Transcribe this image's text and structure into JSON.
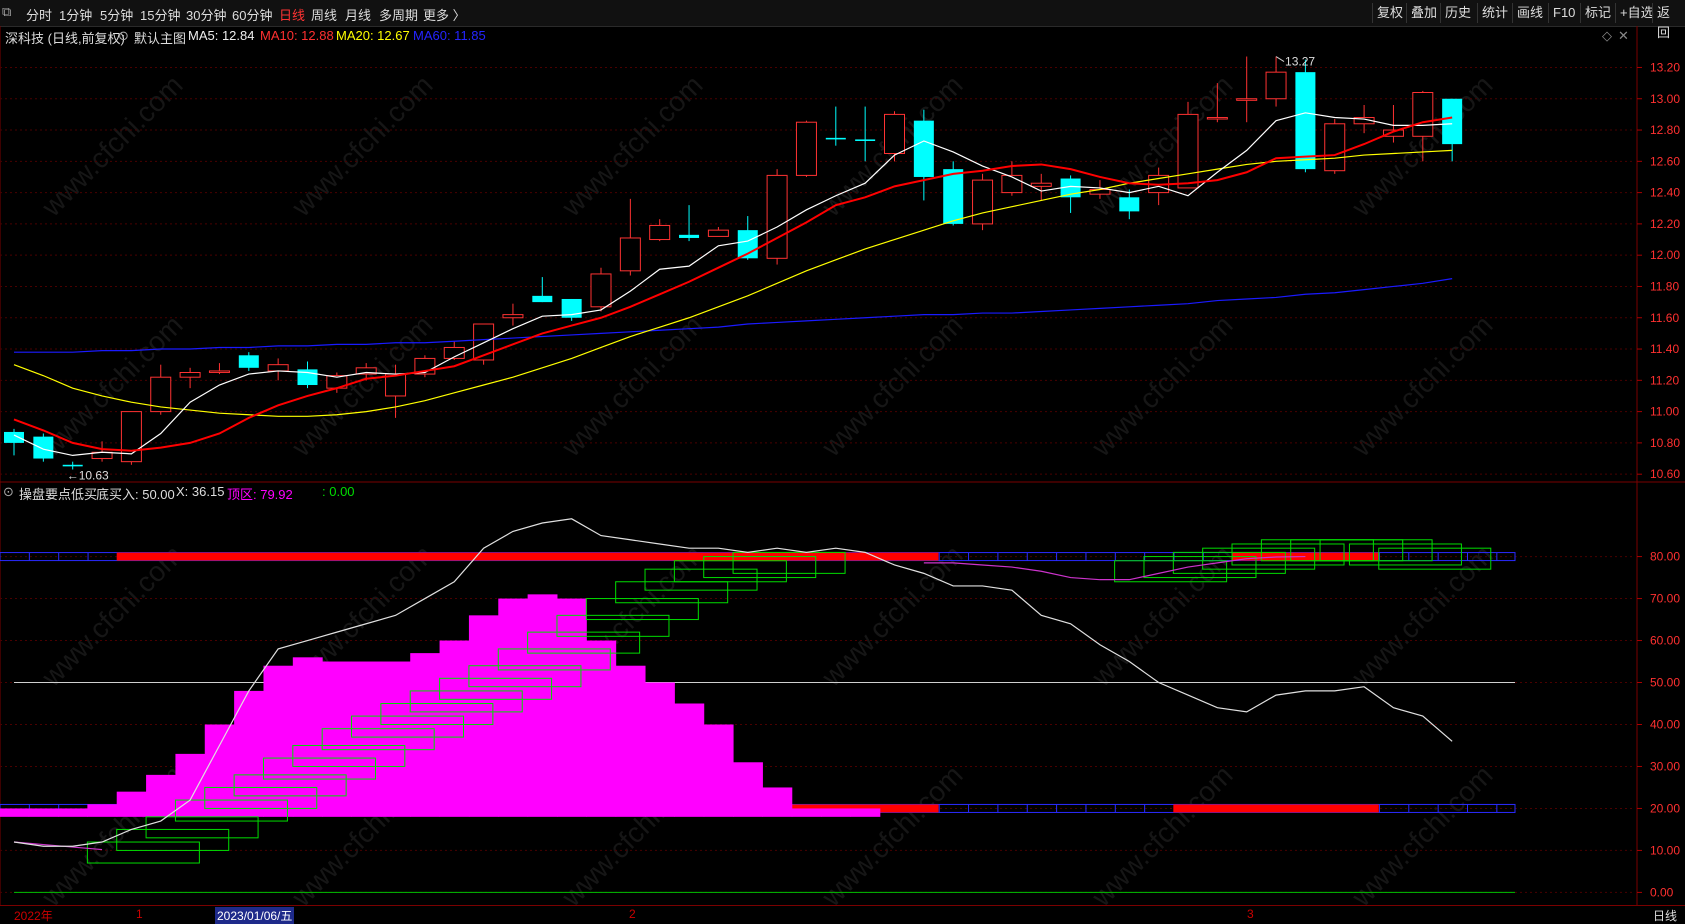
{
  "toolbar": {
    "periods": [
      "分时",
      "1分钟",
      "5分钟",
      "15分钟",
      "30分钟",
      "60分钟",
      "日线",
      "周线",
      "月线",
      "多周期",
      "更多 〉"
    ],
    "active_period": "日线",
    "right_buttons": [
      "复权",
      "叠加",
      "历史",
      "统计",
      "画线",
      "F10",
      "标记",
      "+自选",
      "返回"
    ]
  },
  "main_chart": {
    "stock_label": "深科技 (日线,前复权)",
    "template_label": "默认主图",
    "ma5": "MA5: 12.84",
    "ma10": "MA10: 12.88",
    "ma20": "MA20: 12.67",
    "ma60": "MA60: 11.85",
    "high_marker": "13.27",
    "low_marker": "10.63",
    "yticks": [
      "13.20",
      "13.00",
      "12.80",
      "12.60",
      "12.40",
      "12.20",
      "12.00",
      "11.80",
      "11.60",
      "11.40",
      "11.20",
      "11.00",
      "10.80",
      "10.60"
    ]
  },
  "indicator": {
    "name": "操盘要点低买",
    "bottom_buy": "底买入: 50.00",
    "x_value": "X: 36.15",
    "top_zone": "顶区: 79.92",
    "extra": ": 0.00",
    "yticks": [
      "80.00",
      "70.00",
      "60.00",
      "50.00",
      "40.00",
      "30.00",
      "20.00",
      "10.00",
      "0.00"
    ]
  },
  "timeline": {
    "year": "2022年",
    "m1": "1",
    "date": "2023/01/06/五",
    "m2": "2",
    "m3": "3",
    "period": "日线"
  },
  "watermark": "www.cfchi.com",
  "colors": {
    "up": "#ff3232",
    "down": "#00ffff",
    "ma5": "#ffffff",
    "ma10": "#ff0000",
    "ma20": "#ffff00",
    "ma60": "#1a1aff",
    "magenta": "#ff00ff",
    "green": "#00c000"
  },
  "chart_data": {
    "type": "candlestick",
    "candles": [
      [
        10.87,
        10.8,
        10.89,
        10.72
      ],
      [
        10.84,
        10.7,
        10.86,
        10.68
      ],
      [
        10.66,
        10.65,
        10.68,
        10.63
      ],
      [
        10.7,
        10.74,
        10.81,
        10.68
      ],
      [
        10.68,
        11.0,
        11.0,
        10.66
      ],
      [
        11.0,
        11.22,
        11.3,
        10.98
      ],
      [
        11.22,
        11.25,
        11.28,
        11.15
      ],
      [
        11.26,
        11.26,
        11.31,
        11.24
      ],
      [
        11.36,
        11.28,
        11.38,
        11.26
      ],
      [
        11.26,
        11.3,
        11.34,
        11.2
      ],
      [
        11.27,
        11.17,
        11.32,
        11.15
      ],
      [
        11.15,
        11.23,
        11.25,
        11.12
      ],
      [
        11.24,
        11.28,
        11.31,
        11.2
      ],
      [
        11.1,
        11.24,
        11.3,
        10.96
      ],
      [
        11.24,
        11.34,
        11.36,
        11.22
      ],
      [
        11.34,
        11.41,
        11.45,
        11.33
      ],
      [
        11.33,
        11.56,
        11.56,
        11.3
      ],
      [
        11.6,
        11.62,
        11.69,
        11.55
      ],
      [
        11.74,
        11.7,
        11.86,
        11.7
      ],
      [
        11.72,
        11.6,
        11.72,
        11.58
      ],
      [
        11.67,
        11.88,
        11.92,
        11.64
      ],
      [
        11.9,
        12.11,
        12.36,
        11.87
      ],
      [
        12.1,
        12.19,
        12.23,
        12.09
      ],
      [
        12.13,
        12.11,
        12.32,
        12.09
      ],
      [
        12.12,
        12.16,
        12.18,
        12.12
      ],
      [
        12.16,
        11.98,
        12.25,
        11.97
      ],
      [
        11.98,
        12.51,
        12.55,
        11.94
      ],
      [
        12.51,
        12.85,
        12.86,
        12.5
      ],
      [
        12.75,
        12.74,
        12.95,
        12.7
      ],
      [
        12.74,
        12.73,
        12.95,
        12.6
      ],
      [
        12.65,
        12.9,
        12.92,
        12.6
      ],
      [
        12.86,
        12.5,
        12.93,
        12.35
      ],
      [
        12.55,
        12.2,
        12.6,
        12.19
      ],
      [
        12.2,
        12.48,
        12.52,
        12.16
      ],
      [
        12.4,
        12.51,
        12.6,
        12.38
      ],
      [
        12.44,
        12.46,
        12.52,
        12.35
      ],
      [
        12.49,
        12.37,
        12.51,
        12.27
      ],
      [
        12.39,
        12.42,
        12.48,
        12.36
      ],
      [
        12.37,
        12.28,
        12.42,
        12.23
      ],
      [
        12.4,
        12.51,
        12.56,
        12.32
      ],
      [
        12.43,
        12.9,
        12.98,
        12.43
      ],
      [
        12.88,
        12.88,
        13.1,
        12.85
      ],
      [
        12.99,
        13.0,
        13.27,
        12.85
      ],
      [
        13.0,
        13.17,
        13.27,
        12.95
      ],
      [
        13.17,
        12.55,
        13.25,
        12.53
      ],
      [
        12.54,
        12.84,
        12.87,
        12.52
      ],
      [
        12.84,
        12.88,
        12.96,
        12.78
      ],
      [
        12.76,
        12.8,
        12.96,
        12.72
      ],
      [
        12.76,
        13.04,
        13.05,
        12.6
      ],
      [
        13.0,
        12.71,
        13.0,
        12.6
      ]
    ],
    "ma5": [
      10.85,
      10.76,
      10.72,
      10.74,
      10.73,
      10.86,
      11.06,
      11.17,
      11.24,
      11.26,
      11.25,
      11.22,
      11.25,
      11.24,
      11.25,
      11.35,
      11.44,
      11.53,
      11.61,
      11.62,
      11.65,
      11.77,
      11.91,
      11.93,
      12.06,
      12.09,
      12.18,
      12.29,
      12.38,
      12.46,
      12.64,
      12.73,
      12.66,
      12.57,
      12.5,
      12.41,
      12.44,
      12.43,
      12.4,
      12.44,
      12.38,
      12.53,
      12.67,
      12.86,
      12.91,
      12.88,
      12.87,
      12.83,
      12.83,
      12.84
    ],
    "ma10": [
      10.95,
      10.88,
      10.8,
      10.76,
      10.75,
      10.77,
      10.8,
      10.86,
      10.96,
      11.04,
      11.1,
      11.15,
      11.21,
      11.23,
      11.26,
      11.29,
      11.36,
      11.43,
      11.5,
      11.55,
      11.6,
      11.67,
      11.75,
      11.83,
      11.92,
      12.01,
      12.11,
      12.21,
      12.32,
      12.37,
      12.44,
      12.48,
      12.52,
      12.54,
      12.57,
      12.58,
      12.55,
      12.5,
      12.46,
      12.45,
      12.46,
      12.48,
      12.53,
      12.62,
      12.63,
      12.64,
      12.71,
      12.79,
      12.85,
      12.88
    ],
    "ma20": [
      11.3,
      11.23,
      11.15,
      11.1,
      11.06,
      11.03,
      11.01,
      10.99,
      10.98,
      10.97,
      10.97,
      10.98,
      11.0,
      11.03,
      11.07,
      11.12,
      11.17,
      11.22,
      11.28,
      11.34,
      11.41,
      11.48,
      11.54,
      11.6,
      11.67,
      11.74,
      11.82,
      11.9,
      11.97,
      12.04,
      12.1,
      12.16,
      12.22,
      12.27,
      12.31,
      12.35,
      12.39,
      12.42,
      12.46,
      12.49,
      12.52,
      12.55,
      12.58,
      12.6,
      12.61,
      12.62,
      12.64,
      12.65,
      12.66,
      12.67
    ],
    "ma60": [
      11.38,
      11.38,
      11.38,
      11.39,
      11.39,
      11.4,
      11.4,
      11.41,
      11.41,
      11.42,
      11.42,
      11.43,
      11.43,
      11.44,
      11.44,
      11.45,
      11.46,
      11.47,
      11.48,
      11.49,
      11.5,
      11.51,
      11.52,
      11.53,
      11.54,
      11.56,
      11.57,
      11.58,
      11.59,
      11.6,
      11.61,
      11.62,
      11.62,
      11.63,
      11.63,
      11.64,
      11.65,
      11.66,
      11.67,
      11.68,
      11.69,
      11.71,
      11.72,
      11.73,
      11.75,
      11.76,
      11.78,
      11.8,
      11.82,
      11.85
    ],
    "ind_white": [
      12,
      11,
      11,
      12,
      15,
      17,
      22,
      35,
      48,
      58,
      60,
      62,
      64,
      66,
      70,
      74,
      82,
      86,
      88,
      89,
      85,
      84,
      83,
      82,
      82,
      81,
      82,
      81,
      82,
      81,
      78,
      76,
      73,
      73,
      72,
      66,
      64,
      59,
      55,
      50,
      47,
      44,
      43,
      47,
      48,
      48,
      49,
      44,
      42,
      36
    ],
    "ind_magenta": [
      20,
      20,
      20,
      21,
      24,
      28,
      33,
      40,
      48,
      54,
      56,
      55,
      55,
      55,
      57,
      60,
      66,
      70,
      71,
      70,
      60,
      54,
      50,
      45,
      40,
      31,
      25,
      20,
      20,
      20
    ],
    "ind_pink": [
      78.5,
      78.5,
      78.0,
      77.5,
      76.5,
      75.0,
      74.5,
      74.5,
      76.0,
      77.5,
      78.5,
      79.5,
      79.9,
      80.0
    ],
    "red_band_top": [
      [
        4,
        31
      ],
      [
        42,
        46
      ]
    ],
    "red_band_bottom": [
      [
        4,
        31
      ],
      [
        40,
        46
      ]
    ],
    "ind_yticks_values": [
      80,
      70,
      60,
      50,
      40,
      30,
      20,
      10,
      0
    ],
    "ylim_main": [
      10.55,
      13.35
    ],
    "ylim_ind": [
      -3,
      93
    ]
  }
}
